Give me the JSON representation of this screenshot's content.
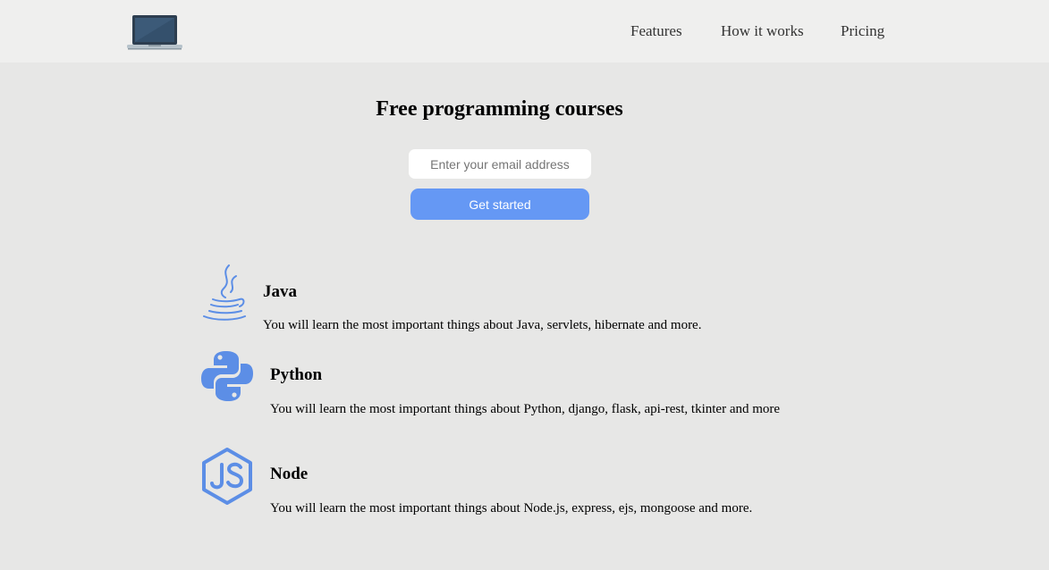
{
  "header": {
    "logo_icon": "laptop-icon",
    "nav": [
      {
        "label": "Features"
      },
      {
        "label": "How it works"
      },
      {
        "label": "Pricing"
      }
    ]
  },
  "hero": {
    "title": "Free programming courses",
    "email_placeholder": "Enter your email address",
    "button_label": "Get started"
  },
  "courses": [
    {
      "icon": "java-icon",
      "name": "Java",
      "description": "You will learn the most important things about Java, servlets, hibernate and more."
    },
    {
      "icon": "python-icon",
      "name": "Python",
      "description": "You will learn the most important things about Python, django, flask, api-rest, tkinter and more"
    },
    {
      "icon": "nodejs-icon",
      "name": "Node",
      "description": "You will learn the most important things about Node.js, express, ejs, mongoose and more."
    }
  ],
  "colors": {
    "accent": "#6598f4",
    "page_background": "#e7e7e6",
    "header_background": "#efefee"
  }
}
